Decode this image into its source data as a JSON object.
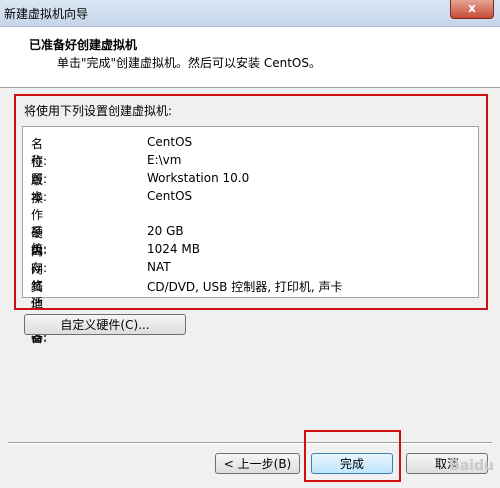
{
  "window": {
    "title": "新建虚拟机向导",
    "close_glyph": "x"
  },
  "header": {
    "title": "已准备好创建虚拟机",
    "subtitle": "单击\"完成\"创建虚拟机。然后可以安装 CentOS。"
  },
  "summary": {
    "label": "将使用下列设置创建虚拟机:",
    "rows": [
      {
        "key": "名称:",
        "value": "CentOS"
      },
      {
        "key": "位置:",
        "value": "E:\\vm"
      },
      {
        "key": "版本:",
        "value": "Workstation 10.0"
      },
      {
        "key": "操作系统:",
        "value": "CentOS"
      },
      {
        "key": "硬盘:",
        "value": "20 GB"
      },
      {
        "key": "内存:",
        "value": "1024 MB"
      },
      {
        "key": "网络适配器:",
        "value": "NAT"
      },
      {
        "key": "其他设备:",
        "value": "CD/DVD, USB 控制器, 打印机, 声卡"
      }
    ]
  },
  "buttons": {
    "customize": "自定义硬件(C)...",
    "back": "< 上一步(B)",
    "finish": "完成",
    "cancel": "取消"
  },
  "watermark": "Baidu"
}
